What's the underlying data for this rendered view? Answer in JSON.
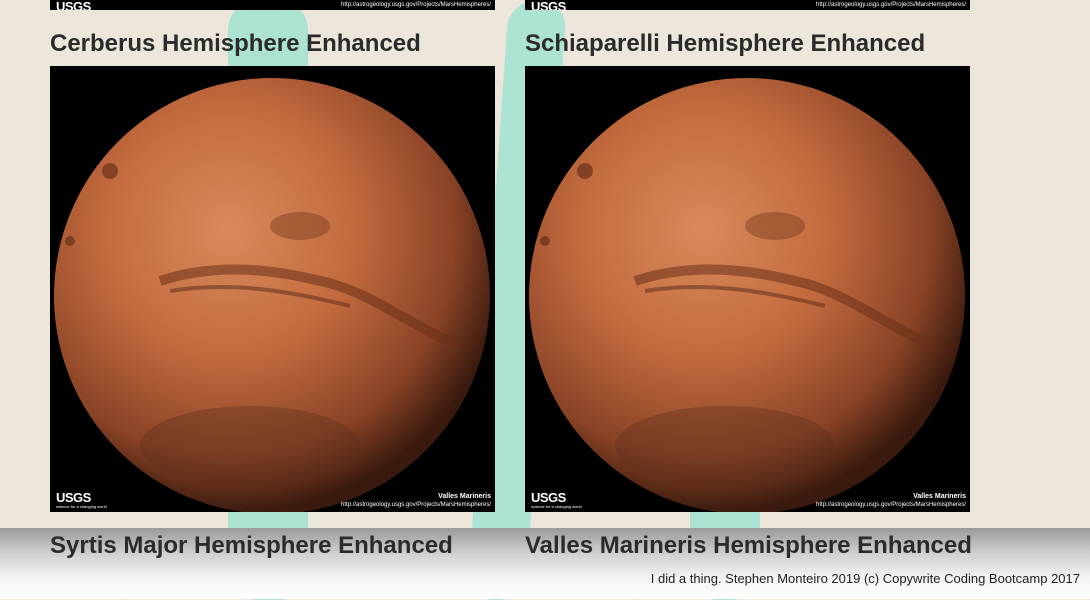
{
  "hemispheres": [
    {
      "title": "Cerberus Hemisphere Enhanced"
    },
    {
      "title": "Schiaparelli Hemisphere Enhanced"
    },
    {
      "title": "Syrtis Major Hemisphere Enhanced"
    },
    {
      "title": "Valles Marineris Hemisphere Enhanced"
    }
  ],
  "image_overlay": {
    "logo": "USGS",
    "logo_sub": "science for a changing world",
    "feature_name": "Valles Marineris",
    "url": "http://astrogeology.usgs.gov/Projects/MarsHemispheres/"
  },
  "footer": {
    "text": "I did a thing. Stephen Monteiro 2019 (c) Copywrite Coding Bootcamp 2017"
  },
  "colors": {
    "background": "#ece6db",
    "accent_stroke": "#a9e3d3",
    "mars": "#c8643c"
  }
}
